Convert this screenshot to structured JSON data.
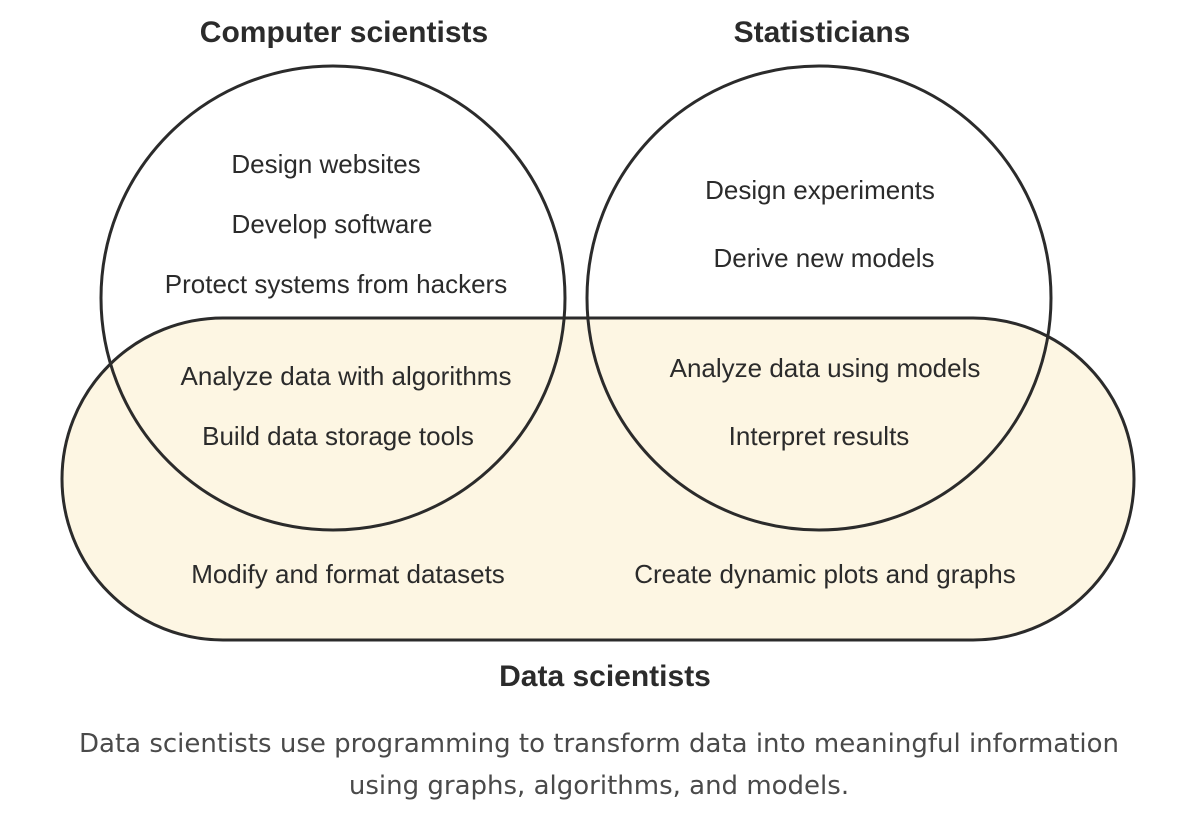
{
  "labels": {
    "computer_scientists": "Computer scientists",
    "statisticians": "Statisticians",
    "data_scientists": "Data scientists"
  },
  "computer_scientists_only": [
    "Design websites",
    "Develop software",
    "Protect systems from hackers"
  ],
  "statisticians_only": [
    "Design experiments",
    "Derive new models"
  ],
  "cs_and_data": [
    "Analyze data with algorithms",
    "Build data storage tools"
  ],
  "stats_and_data": [
    "Analyze data using models",
    "Interpret results"
  ],
  "data_scientists_only": [
    "Modify and format datasets",
    "Create dynamic plots and graphs"
  ],
  "caption": {
    "line1": "Data scientists use programming to transform data into meaningful information",
    "line2": "using graphs, algorithms, and models."
  },
  "colors": {
    "data_region_fill": "#fdf6e3",
    "outline": "#2b2b2b",
    "text": "#2b2b2b",
    "caption": "#4a4a4a"
  }
}
